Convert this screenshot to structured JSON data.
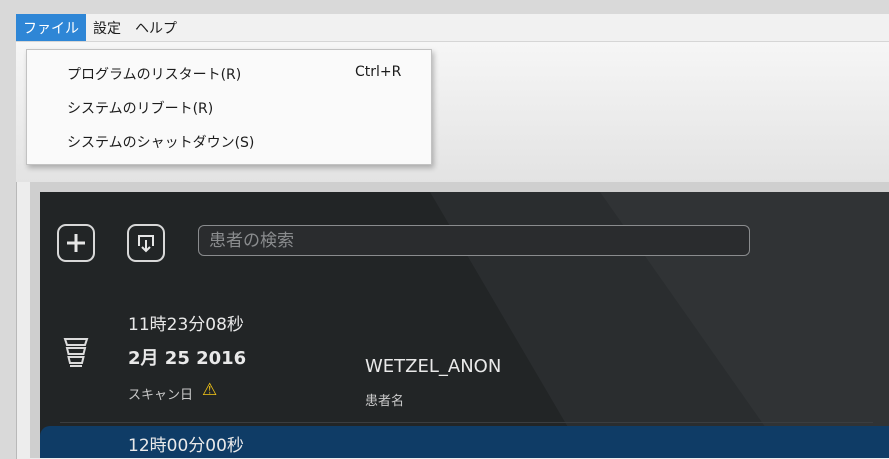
{
  "menubar": {
    "file": "ファイル",
    "settings": "設定",
    "help": "ヘルプ"
  },
  "file_menu": {
    "items": [
      {
        "label": "プログラムのリスタート(R)",
        "shortcut": "Ctrl+R"
      },
      {
        "label": "システムのリブート(R)"
      },
      {
        "label": "システムのシャットダウン(S)"
      }
    ]
  },
  "toolbar": {
    "add_icon": "plus-icon",
    "import_icon": "import-icon",
    "search_placeholder": "患者の検索"
  },
  "records": [
    {
      "time": "11時23分08秒",
      "date": "2月 25 2016",
      "date_caption": "スキャン日",
      "warning_icon": "warning-icon",
      "patient_name": "WETZEL_ANON",
      "patient_caption": "患者名"
    },
    {
      "time": "12時00分00秒"
    }
  ],
  "colors": {
    "menu_active": "#2e86d6",
    "panel_bg": "#222526",
    "selected_row": "#0f3c66",
    "warning": "#f2c417"
  }
}
